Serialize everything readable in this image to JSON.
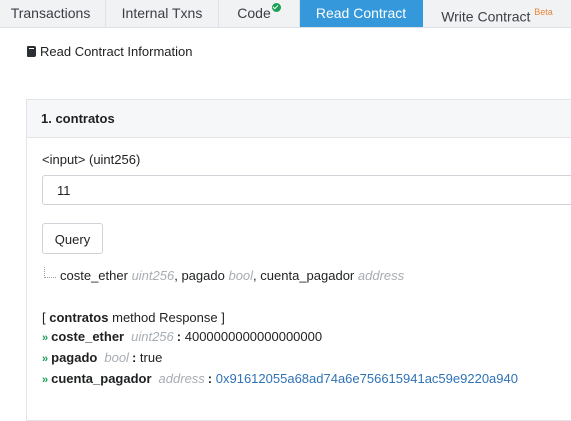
{
  "tabs": [
    {
      "label": "Transactions"
    },
    {
      "label": "Internal Txns"
    },
    {
      "label": "Code"
    },
    {
      "label": "Read Contract"
    },
    {
      "label": "Write Contract",
      "badge": "Beta"
    }
  ],
  "page_title": "Read Contract Information",
  "panel": {
    "heading": "1. contratos",
    "input_label": "<input> (uint256)",
    "input_value": "11",
    "query_label": "Query",
    "outputs": [
      {
        "name": "coste_ether",
        "type": "uint256"
      },
      {
        "name": "pagado",
        "type": "bool"
      },
      {
        "name": "cuenta_pagador",
        "type": "address"
      }
    ],
    "response": {
      "open": "[",
      "method": "contratos",
      "label": "method Response ]",
      "rows": [
        {
          "name": "coste_ether",
          "type": "uint256",
          "value": "4000000000000000000"
        },
        {
          "name": "pagado",
          "type": "bool",
          "value": "true"
        },
        {
          "name": "cuenta_pagador",
          "type": "address",
          "value": "0x91612055a68ad74a6e756615941ac59e9220a940"
        }
      ]
    }
  },
  "colors": {
    "accent": "#3498db",
    "verified": "#1b9e55",
    "beta": "#e8873b",
    "link": "#2f72b6"
  },
  "icons": {
    "title": "book-icon",
    "code_tab": "check-circle-icon",
    "response_row": "double-chevron-right-icon"
  }
}
